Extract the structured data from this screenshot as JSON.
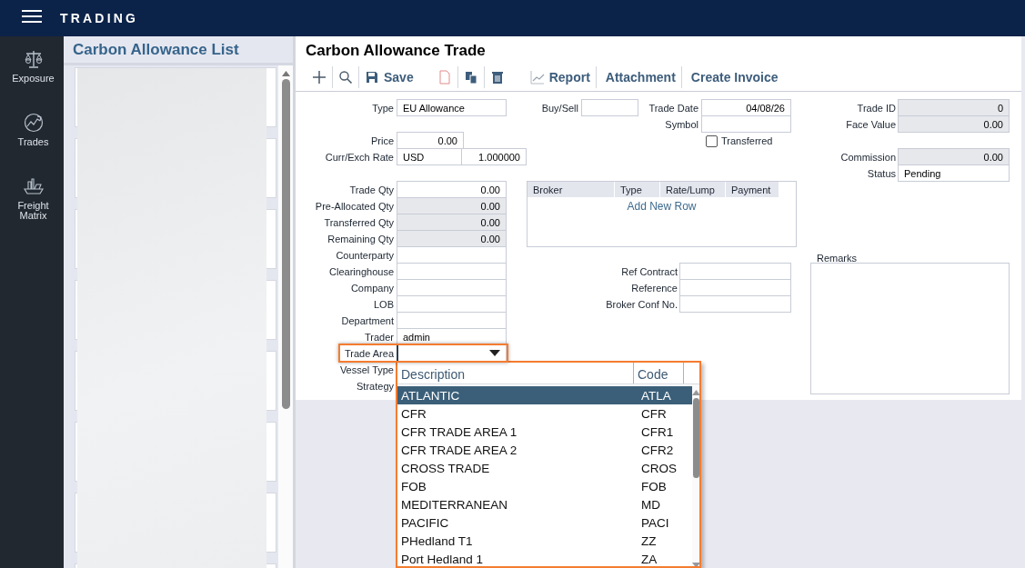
{
  "app": {
    "title": "TRADING"
  },
  "nav": [
    {
      "label": "Exposure",
      "selected": false
    },
    {
      "label": "Trades",
      "selected": false
    },
    {
      "label": "Freight Matrix",
      "selected": false
    }
  ],
  "list_panel": {
    "title": "Carbon Allowance List"
  },
  "form": {
    "title": "Carbon Allowance Trade",
    "toolbar": [
      "Save",
      "Report",
      "Attachment",
      "Create Invoice"
    ],
    "left_fields": [
      {
        "label": "Type",
        "kind": "text",
        "value": "EU Allowance",
        "disabled": false
      },
      {
        "label": "Price",
        "kind": "number",
        "value": "0.00",
        "disabled": false
      },
      {
        "label": "Curr/Exch Rate",
        "kind": "pair",
        "values": [
          "USD",
          "1.000000"
        ],
        "disabled": false
      },
      {
        "label": "Trade Qty",
        "kind": "number",
        "value": "0.00",
        "disabled": false
      },
      {
        "label": "Pre-Allocated Qty",
        "kind": "number",
        "value": "0.00",
        "disabled": true
      },
      {
        "label": "Transferred Qty",
        "kind": "number",
        "value": "0.00",
        "disabled": true
      },
      {
        "label": "Remaining Qty",
        "kind": "number",
        "value": "0.00",
        "disabled": true
      },
      {
        "label": "Counterparty",
        "kind": "text",
        "disabled": false
      },
      {
        "label": "Clearinghouse",
        "kind": "text",
        "disabled": false
      },
      {
        "label": "Company",
        "kind": "text",
        "disabled": false
      },
      {
        "label": "LOB",
        "kind": "text",
        "disabled": false
      },
      {
        "label": "Department",
        "kind": "text",
        "disabled": false
      },
      {
        "label": "Trader",
        "kind": "text",
        "value": "admin",
        "disabled": false
      },
      {
        "label": "Trade Area",
        "kind": "select",
        "expanded": true,
        "disabled": false
      },
      {
        "label": "Vessel Type",
        "kind": "label"
      },
      {
        "label": "Strategy",
        "kind": "label"
      }
    ],
    "center_fields": [
      {
        "label": "Buy/Sell",
        "kind": "text"
      },
      {
        "label": "Trade Date",
        "kind": "number",
        "value": "04/08/26"
      },
      {
        "label": "Symbol",
        "kind": "text"
      },
      {
        "label": "Ref Contract",
        "kind": "text"
      },
      {
        "label": "Reference",
        "kind": "text"
      },
      {
        "label": "Broker Conf No.",
        "kind": "text"
      }
    ],
    "transferred": {
      "label": "Transferred",
      "checked": false
    },
    "right_fields": [
      {
        "label": "Trade ID",
        "kind": "number",
        "value": "0",
        "disabled": true
      },
      {
        "label": "Face Value",
        "kind": "number",
        "value": "0.00",
        "disabled": true
      },
      {
        "label": "Commission",
        "kind": "number",
        "value": "0.00",
        "disabled": true
      },
      {
        "label": "Status",
        "kind": "text",
        "value": "Pending",
        "disabled": false
      }
    ],
    "broker_table": {
      "columns": [
        "Broker",
        "Type",
        "Rate/Lump",
        "Payment"
      ],
      "add_row": "Add New Row"
    },
    "remarks": {
      "label": "Remarks"
    },
    "dropdown": {
      "highlighted": true,
      "columns": [
        "Description",
        "Code"
      ],
      "rows": [
        {
          "description": "ATLANTIC",
          "code": "ATLA",
          "selected": true
        },
        {
          "description": "CFR",
          "code": "CFR",
          "selected": false
        },
        {
          "description": "CFR TRADE AREA 1",
          "code": "CFR1",
          "selected": false
        },
        {
          "description": "CFR TRADE AREA 2",
          "code": "CFR2",
          "selected": false
        },
        {
          "description": "CROSS TRADE",
          "code": "CROS",
          "selected": false
        },
        {
          "description": "FOB",
          "code": "FOB",
          "selected": false
        },
        {
          "description": "MEDITERRANEAN",
          "code": "MD",
          "selected": false
        },
        {
          "description": "PACIFIC",
          "code": "PACI",
          "selected": false
        },
        {
          "description": "PHedland T1",
          "code": "ZZ",
          "selected": false
        },
        {
          "description": "Port Hedland 1",
          "code": "ZA",
          "selected": false
        }
      ]
    }
  }
}
